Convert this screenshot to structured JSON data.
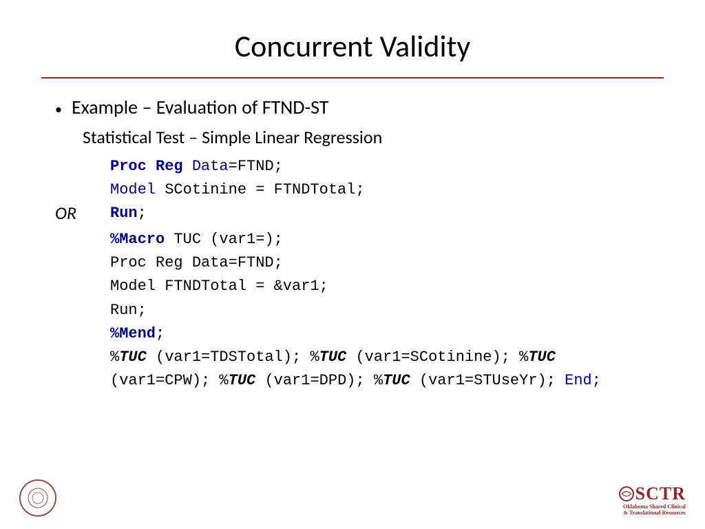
{
  "title": "Concurrent Validity",
  "bullet": "Example – Evaluation of FTND-ST",
  "sub1": "Statistical Test – Simple Linear Regression",
  "or_label": "OR",
  "code1": {
    "l1_a": "Proc Reg ",
    "l1_b": "Data",
    "l1_c": "=FTND;",
    "l2_a": "Model",
    "l2_b": " SCotinine = FTNDTotal;",
    "l3_a": "Run",
    "l3_b": ";"
  },
  "code2": {
    "l1_a": "%Macro",
    "l1_b": " TUC (var1=);",
    "l2": "Proc Reg Data=FTND;",
    "l3": "Model FTNDTotal = &var1;",
    "l4": "Run;",
    "l5_a": "%Mend",
    "l5_b": ";",
    "l6_p": "%",
    "l6_tuc": "TUC",
    "l6_a": " (var1=TDSTotal); %",
    "l6_b": " (var1=SCotinine); %",
    "l6_c": " (var1=CPW); %",
    "l6_d": " (var1=DPD); %",
    "l6_e": " (var1=STUseYr); ",
    "l7": "End;"
  },
  "footer": {
    "seal_text": "",
    "sctr_main": "SCTR",
    "sctr_sub1": "Oklahoma Shared Clinical",
    "sctr_sub2": "& Translational Resources"
  }
}
